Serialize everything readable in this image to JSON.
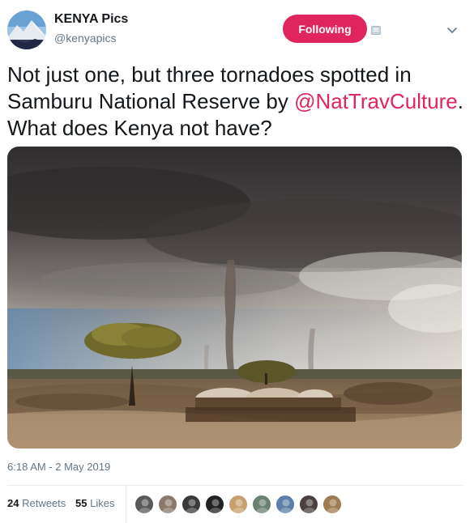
{
  "account": {
    "name": "KENYA Pics",
    "handle": "@kenyapics"
  },
  "follow_button": {
    "label": "Following",
    "color": "#e0245e"
  },
  "tweet": {
    "text_before": "Not just one, but three tornadoes spotted in Samburu National Reserve by ",
    "mention": "@NatTravCulture",
    "text_after": ". What does Kenya not have?",
    "mention_color": "#e0245e"
  },
  "timestamp": "6:18 AM - 2 May 2019",
  "stats": {
    "retweets_count": "24",
    "retweets_label": "Retweets",
    "likes_count": "55",
    "likes_label": "Likes"
  },
  "icons": [
    "notification-icon",
    "caret-down-icon"
  ],
  "likers": [
    {
      "color": "#5a5a5a"
    },
    {
      "color": "#8a7a6a"
    },
    {
      "color": "#3a3a3a"
    },
    {
      "color": "#222222"
    },
    {
      "color": "#c8a070"
    },
    {
      "color": "#6a8070"
    },
    {
      "color": "#5b7fa8"
    },
    {
      "color": "#4a4040"
    },
    {
      "color": "#a07a50"
    }
  ]
}
